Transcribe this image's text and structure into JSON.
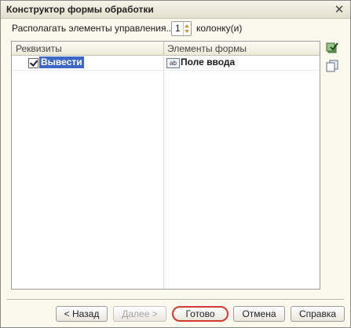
{
  "window": {
    "title": "Конструктор формы обработки",
    "close_icon": "close-icon"
  },
  "layout_row": {
    "label_before": "Располагать элементы управления...",
    "columns_value": "1",
    "label_after": "колонку(и)"
  },
  "grid": {
    "columns": [
      "Реквизиты",
      "Элементы формы"
    ],
    "rows": [
      {
        "checked": true,
        "attribute": "Вывести",
        "element_icon": "ab-icon",
        "element": "Поле ввода"
      }
    ]
  },
  "side_buttons": [
    {
      "name": "check-all-icon"
    },
    {
      "name": "copy-icon"
    }
  ],
  "buttons": {
    "back": "< Назад",
    "next": "Далее >",
    "done": "Готово",
    "cancel": "Отмена",
    "help": "Справка"
  },
  "colors": {
    "selection": "#3d68c6",
    "highlight_ring": "#d43a2f",
    "window_bg": "#fbf9ee"
  }
}
